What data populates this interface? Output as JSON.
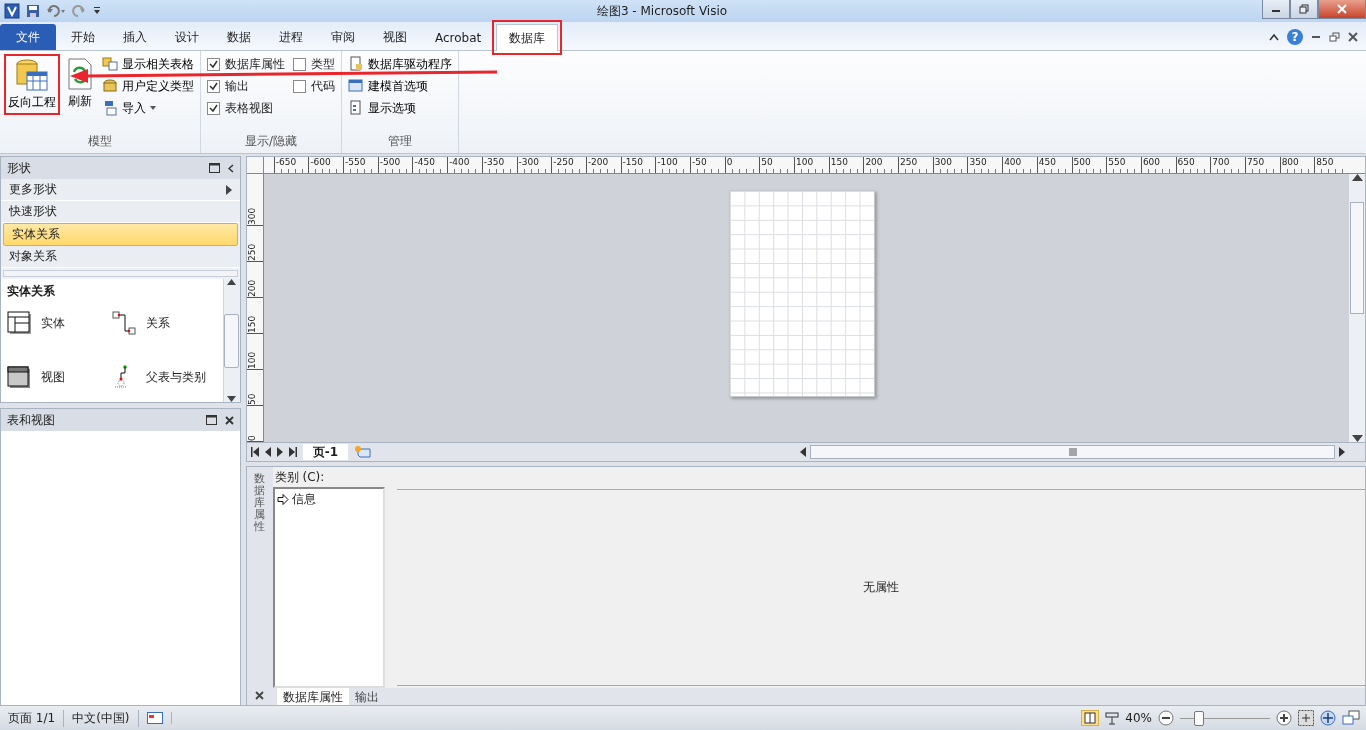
{
  "window": {
    "title": "绘图3 - Microsoft Visio"
  },
  "ribbon_tabs": [
    {
      "label": "文件",
      "kind": "file",
      "selected": false,
      "highlighted": false
    },
    {
      "label": "开始",
      "kind": "tab",
      "selected": false,
      "highlighted": false
    },
    {
      "label": "插入",
      "kind": "tab",
      "selected": false,
      "highlighted": false
    },
    {
      "label": "设计",
      "kind": "tab",
      "selected": false,
      "highlighted": false
    },
    {
      "label": "数据",
      "kind": "tab",
      "selected": false,
      "highlighted": false
    },
    {
      "label": "进程",
      "kind": "tab",
      "selected": false,
      "highlighted": false
    },
    {
      "label": "审阅",
      "kind": "tab",
      "selected": false,
      "highlighted": false
    },
    {
      "label": "视图",
      "kind": "tab",
      "selected": false,
      "highlighted": false
    },
    {
      "label": "Acrobat",
      "kind": "tab",
      "selected": false,
      "highlighted": false
    },
    {
      "label": "数据库",
      "kind": "tab",
      "selected": true,
      "highlighted": true
    }
  ],
  "help_button": {
    "label": "?"
  },
  "ribbon_groups": [
    {
      "label": "模型",
      "columns": [
        [
          {
            "kind": "large",
            "label": "反向工程",
            "highlighted": true
          }
        ],
        [
          {
            "kind": "large",
            "label": "刷新",
            "highlighted": false
          }
        ],
        [
          {
            "kind": "small",
            "label": "显示相关表格",
            "dropdown": false
          },
          {
            "kind": "small",
            "label": "用户定义类型",
            "dropdown": false
          },
          {
            "kind": "small",
            "label": "导入",
            "dropdown": true
          }
        ]
      ]
    },
    {
      "label": "显示/隐藏",
      "columns": [
        [
          {
            "kind": "checkbox",
            "label": "数据库属性",
            "checked": true
          },
          {
            "kind": "checkbox",
            "label": "输出",
            "checked": true
          },
          {
            "kind": "checkbox",
            "label": "表格视图",
            "checked": true
          }
        ],
        [
          {
            "kind": "checkbox",
            "label": "类型",
            "checked": false
          },
          {
            "kind": "checkbox",
            "label": "代码",
            "checked": false
          }
        ]
      ]
    },
    {
      "label": "管理",
      "columns": [
        [
          {
            "kind": "small",
            "label": "数据库驱动程序",
            "dropdown": false
          },
          {
            "kind": "small",
            "label": "建模首选项",
            "dropdown": false
          },
          {
            "kind": "small",
            "label": "显示选项",
            "dropdown": false
          }
        ]
      ]
    }
  ],
  "shapes_panel": {
    "title": "形状",
    "items": [
      {
        "label": "更多形状",
        "kind": "submenu",
        "selected": false
      },
      {
        "label": "快速形状",
        "kind": "stencil",
        "selected": false
      },
      {
        "label": "实体关系",
        "kind": "stencil",
        "selected": true
      },
      {
        "label": "对象关系",
        "kind": "stencil",
        "selected": false
      }
    ],
    "stencil": {
      "title": "实体关系",
      "shapes": [
        {
          "label": "实体"
        },
        {
          "label": "关系"
        },
        {
          "label": "视图"
        },
        {
          "label": "父表与类别"
        }
      ]
    }
  },
  "tables_panel": {
    "title": "表和视图"
  },
  "ruler": {
    "horizontal": [
      "-650",
      "-600",
      "-550",
      "-500",
      "-450",
      "-400",
      "-350",
      "-300",
      "-250",
      "-200",
      "-150",
      "-100",
      "-50",
      "0",
      "50",
      "100",
      "150",
      "200",
      "250",
      "300",
      "350",
      "400",
      "450",
      "500",
      "550",
      "600",
      "650",
      "700",
      "750",
      "800",
      "850"
    ],
    "vertical": [
      "300",
      "250",
      "200",
      "150",
      "100",
      "50",
      "0"
    ]
  },
  "page_tabs": [
    {
      "label": "页-1",
      "selected": true
    }
  ],
  "properties_window": {
    "title": "数据库属性",
    "category_label": "类别 (C):",
    "categories": [
      {
        "label": "信息",
        "selected": true
      }
    ],
    "message": "无属性",
    "tabs": [
      {
        "label": "数据库属性",
        "selected": true
      },
      {
        "label": "输出",
        "selected": false
      }
    ]
  },
  "status_bar": {
    "page": "页面 1/1",
    "language": "中文(中国)",
    "zoom": "40%",
    "zoom_level": {
      "level": 0.2
    }
  }
}
